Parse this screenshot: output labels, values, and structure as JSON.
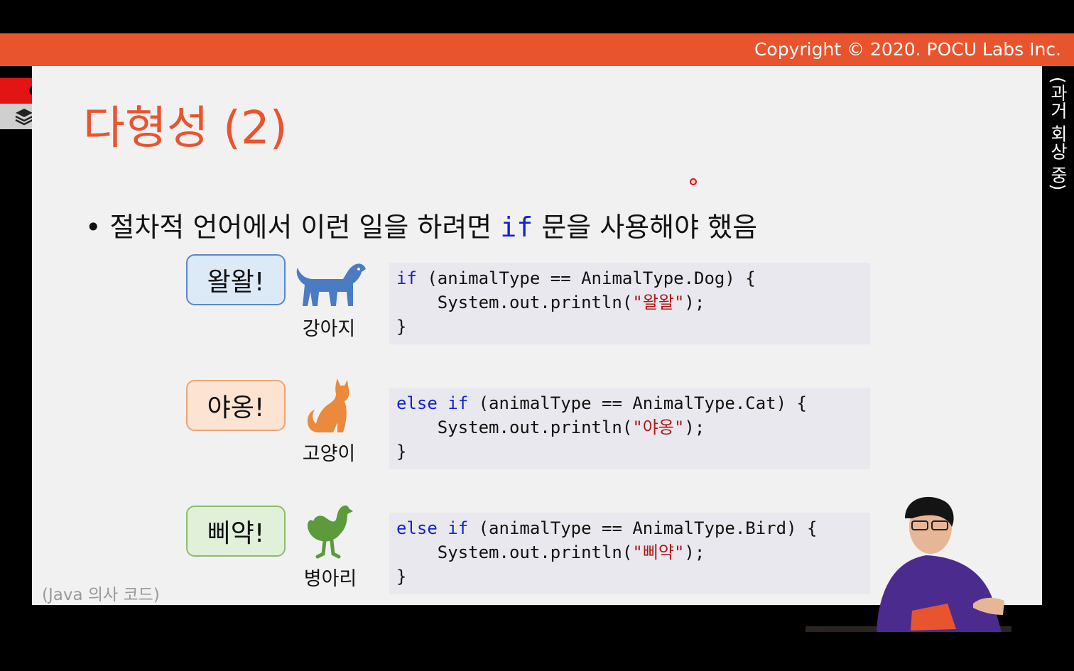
{
  "header": {
    "copyright": "Copyright © 2020. POCU Labs Inc."
  },
  "side_label": "(과거 회상 중)",
  "title": "다형성 (2)",
  "bullet": {
    "prefix": "• 절차적 언어에서 이런 일을 하려면 ",
    "keyword": "if",
    "suffix": " 문을 사용해야 했음"
  },
  "rows": [
    {
      "sound": "왈왈!",
      "animal": "강아지",
      "icon": "dog-icon",
      "code_kw": "if",
      "code_cond": " (animalType == AnimalType.Dog) {",
      "code_print": "    System.out.println(",
      "code_str": "\"왈왈\"",
      "code_end": ");",
      "code_close": "}"
    },
    {
      "sound": "야옹!",
      "animal": "고양이",
      "icon": "cat-icon",
      "code_kw": "else if",
      "code_cond": " (animalType == AnimalType.Cat) {",
      "code_print": "    System.out.println(",
      "code_str": "\"야옹\"",
      "code_end": ");",
      "code_close": "}"
    },
    {
      "sound": "삐약!",
      "animal": "병아리",
      "icon": "chicken-icon",
      "code_kw": "else if",
      "code_cond": " (animalType == AnimalType.Bird) {",
      "code_print": "    System.out.println(",
      "code_str": "\"삐약\"",
      "code_end": ");",
      "code_close": "}"
    }
  ],
  "footnote": "(Java 의사 코드)",
  "colors": {
    "accent": "#e8542e",
    "keyword": "#1222d6",
    "string": "#b01818",
    "dog": "#4a7cc4",
    "cat": "#e98a3c",
    "chicken": "#5c9a3c"
  }
}
